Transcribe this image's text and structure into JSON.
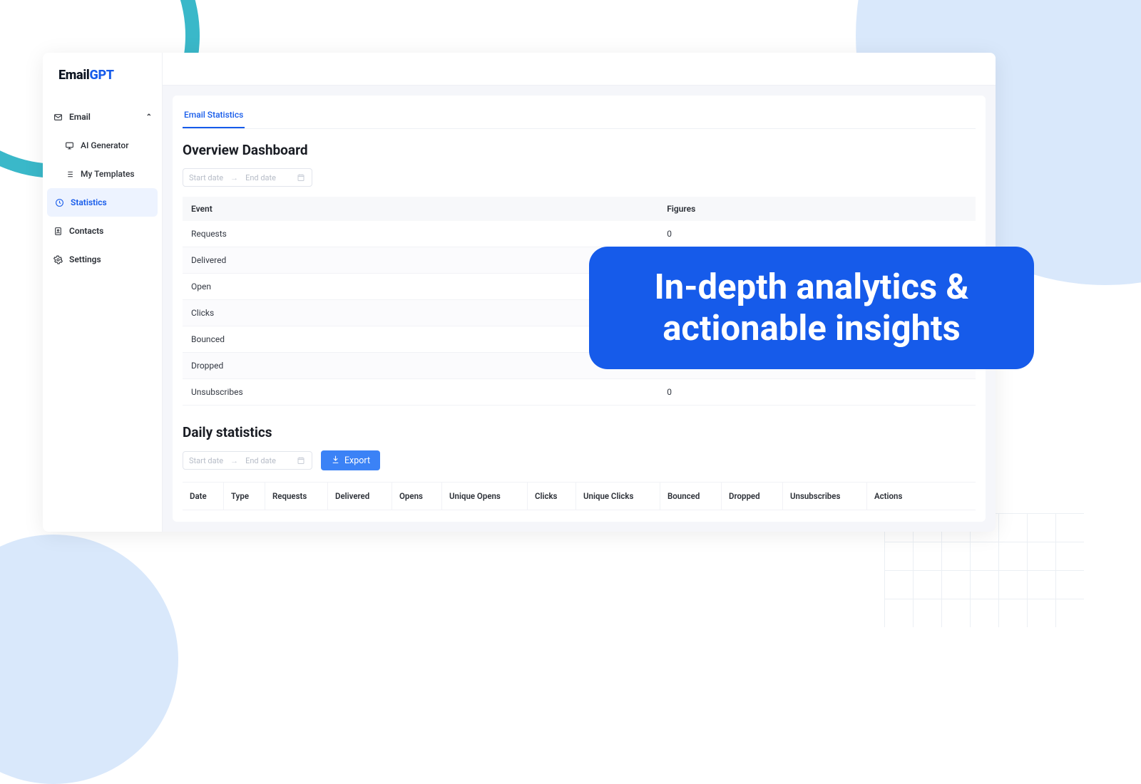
{
  "logo": {
    "part1": "Email",
    "part2": "GPT"
  },
  "sidebar": {
    "email_label": "Email",
    "ai_generator_label": "AI Generator",
    "my_templates_label": "My Templates",
    "statistics_label": "Statistics",
    "contacts_label": "Contacts",
    "settings_label": "Settings"
  },
  "tab": {
    "label": "Email Statistics"
  },
  "overview": {
    "title": "Overview Dashboard",
    "date_start_placeholder": "Start date",
    "date_end_placeholder": "End date",
    "columns": {
      "event": "Event",
      "figures": "Figures"
    },
    "rows": [
      {
        "event": "Requests",
        "figure": "0"
      },
      {
        "event": "Delivered",
        "figure": ""
      },
      {
        "event": "Open",
        "figure": ""
      },
      {
        "event": "Clicks",
        "figure": ""
      },
      {
        "event": "Bounced",
        "figure": ""
      },
      {
        "event": "Dropped",
        "figure": ""
      },
      {
        "event": "Unsubscribes",
        "figure": "0"
      }
    ]
  },
  "daily": {
    "title": "Daily statistics",
    "date_start_placeholder": "Start date",
    "date_end_placeholder": "End date",
    "export_label": "Export",
    "columns": [
      "Date",
      "Type",
      "Requests",
      "Delivered",
      "Opens",
      "Unique Opens",
      "Clicks",
      "Unique Clicks",
      "Bounced",
      "Dropped",
      "Unsubscribes",
      "Actions"
    ]
  },
  "callout": {
    "line1": "In-depth analytics &",
    "line2": "actionable insights"
  }
}
